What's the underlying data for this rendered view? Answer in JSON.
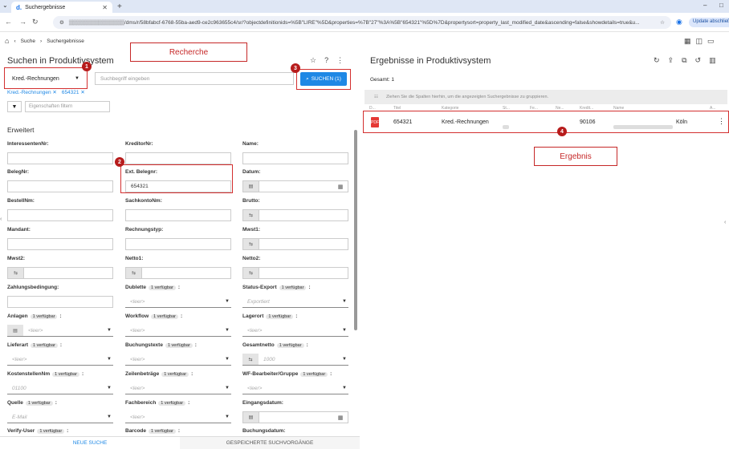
{
  "browser": {
    "tab_title": "Suchergebnisse",
    "tab_favicon": "d.",
    "url": "▒▒▒▒▒▒▒▒▒▒▒▒▒▒▒/dms/r/58bfabcf-6768-55ba-aed9-ce2c963655c4/sr/?objectdefinitionids=%5B\"LIRE\"%5D&properties=%7B\"27\"%3A%5B\"654321\"%5D%7D&propertysort=property_last_modified_date&ascending=false&showdetails=true&u...",
    "update_label": "Update abschließen"
  },
  "breadcrumb": {
    "items": [
      "Suche",
      "Suchergebnisse"
    ]
  },
  "search_panel": {
    "title": "Suchen in Produktivsystem",
    "category_value": "Kred.-Rechnungen",
    "search_placeholder": "Suchbegriff eingeben",
    "search_button_label": "SUCHEN (1)",
    "chips": [
      "Kred.-Rechnungen ✕",
      "654321 ✕"
    ],
    "property_filter_placeholder": "Eigenschaften filtern",
    "section_title": "Erweitert",
    "annotation_label": "Recherche",
    "badges": {
      "one": "1",
      "two": "2",
      "three": "3"
    },
    "avail_text": "1 verfügbar",
    "fields": {
      "interessentennr": "InteressentenNr:",
      "kreditornr": "KreditorNr:",
      "name": "Name:",
      "belegnr": "BelegNr:",
      "ext_belegnr": "Ext. Belegnr:",
      "ext_belegnr_value": "654321",
      "datum": "Datum:",
      "bestellnr": "BestellNm:",
      "sachkontonr": "SachkontoNm:",
      "brutto": "Brutto:",
      "mandant": "Mandant:",
      "rechnungstyp": "Rechnungstyp:",
      "mwst1": "Mwst1:",
      "mwst2": "Mwst2:",
      "netto1": "Netto1:",
      "netto2": "Netto2:",
      "zahlungsbedingung": "Zahlungsbedingung:",
      "dublette": "Dublette",
      "status_export": "Status-Export",
      "status_export_value": "Exportiert",
      "anlagen": "Anlagen",
      "workflow": "Workflow",
      "lagerort": "Lagerort",
      "lieferart": "Lieferart",
      "buchungstexte": "Buchungstexte",
      "gesamtnetto": "Gesamtnetto",
      "gesamtnetto_value": "1000",
      "kostenstellennr": "KostenstellenNm",
      "kostenstellennr_value": "01100",
      "zeilenbetraege": "Zeilenbeträge",
      "wf_bearbeiter": "WF-Bearbeiter/Gruppe",
      "quelle": "Quelle",
      "quelle_value": "E-Mail",
      "fachbereich": "Fachbereich",
      "eingangsdatum": "Eingangsdatum:",
      "verify_user": "Verify-User",
      "barcode": "Barcode",
      "buchungsdatum": "Buchungsdatum:",
      "leer": "<leer>",
      "colon": ":"
    },
    "bottom_tabs": [
      "NEUE SUCHE",
      "GESPEICHERTE SUCHVORGÄNGE"
    ]
  },
  "results_panel": {
    "title": "Ergebnisse in Produktivsystem",
    "total": "Gesamt: 1",
    "group_hint": "Ziehen Sie die Spalten hierhin, um die angezeigten Suchergebnisse zu gruppieren.",
    "columns": [
      "D...",
      "Titel",
      "Kategorie",
      "St...",
      "Fe...",
      "Ne...",
      "Kredit...",
      "Name",
      "A..."
    ],
    "row": {
      "title": "654321",
      "category": "Kred.-Rechnungen",
      "kreditor": "90106",
      "name_suffix": "Köln"
    },
    "badge": "4",
    "annotation_label": "Ergebnis"
  },
  "colors": {
    "accent": "#1e88e5",
    "annotation": "#c62828",
    "pdf": "#e53935"
  }
}
